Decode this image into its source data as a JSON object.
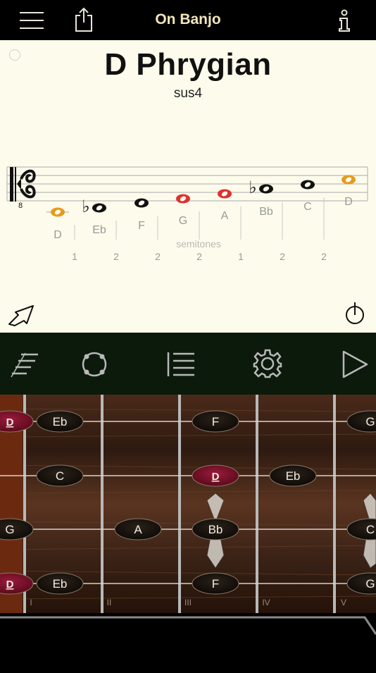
{
  "header": {
    "title": "On Banjo",
    "menu_icon": "hamburger-menu-icon",
    "share_icon": "share-icon",
    "info_icon": "info-icon"
  },
  "score": {
    "scale_name": "D Phrygian",
    "chord_quality": "sus4",
    "clef_octave": "8",
    "notes": [
      {
        "name": "D",
        "accidental": "",
        "color": "#e89a1a"
      },
      {
        "name": "Eb",
        "accidental": "♭",
        "color": "#111111"
      },
      {
        "name": "F",
        "accidental": "",
        "color": "#111111"
      },
      {
        "name": "G",
        "accidental": "",
        "color": "#e03030"
      },
      {
        "name": "A",
        "accidental": "",
        "color": "#e03030"
      },
      {
        "name": "Bb",
        "accidental": "♭",
        "color": "#111111"
      },
      {
        "name": "C",
        "accidental": "",
        "color": "#111111"
      },
      {
        "name": "D",
        "accidental": "",
        "color": "#e89a1a"
      }
    ],
    "semitones_label": "semitones",
    "semitones": [
      "1",
      "2",
      "2",
      "2",
      "1",
      "2",
      "2"
    ],
    "expand_icon": "expand-arrow-icon",
    "power_icon": "power-icon"
  },
  "toolbar": {
    "items": [
      {
        "icon": "fretboard-strings-icon"
      },
      {
        "icon": "circle-of-fifths-icon"
      },
      {
        "icon": "list-icon"
      },
      {
        "icon": "settings-gear-icon"
      },
      {
        "icon": "play-icon"
      }
    ]
  },
  "fretboard": {
    "fret_numbers": [
      "I",
      "II",
      "III",
      "IV",
      "V"
    ],
    "strings": [
      {
        "notes": [
          {
            "label": "D",
            "root": true
          },
          {
            "label": "Eb"
          },
          {
            "label": "F"
          },
          {
            "label": "G"
          }
        ]
      },
      {
        "notes": [
          {
            "label": "C"
          },
          {
            "label": "D",
            "root": true
          },
          {
            "label": "Eb"
          }
        ]
      },
      {
        "notes": [
          {
            "label": "G"
          },
          {
            "label": "A"
          },
          {
            "label": "Bb"
          },
          {
            "label": "C"
          }
        ]
      },
      {
        "notes": [
          {
            "label": "D",
            "root": true
          },
          {
            "label": "Eb"
          },
          {
            "label": "F"
          },
          {
            "label": "G"
          }
        ]
      }
    ],
    "colors": {
      "note_fill": "#1a1410",
      "root_fill": "#7a1028",
      "string": "#d8d2c8",
      "fret": "#b8b8b8",
      "nut": "#6b2a10"
    }
  }
}
